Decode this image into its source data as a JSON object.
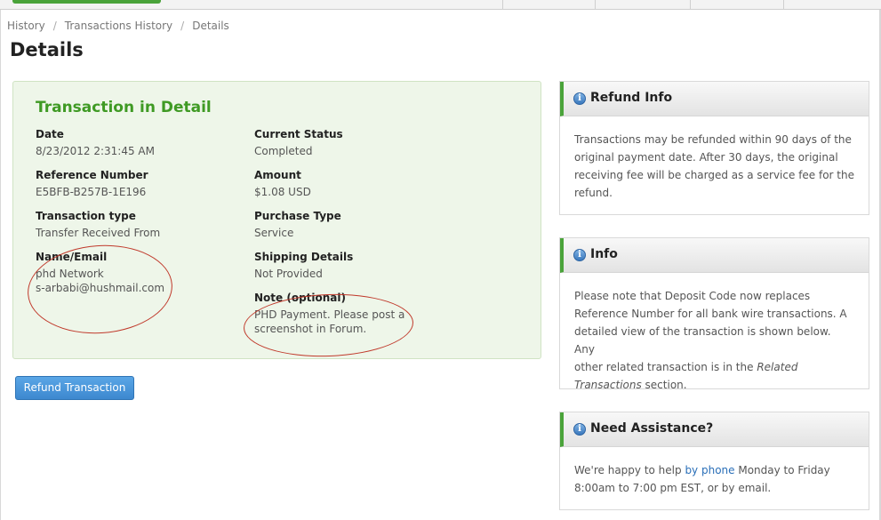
{
  "breadcrumb": {
    "items": [
      "History",
      "Transactions History",
      "Details"
    ],
    "separator": "/"
  },
  "page_title": "Details",
  "transaction": {
    "heading": "Transaction in Detail",
    "date": {
      "label": "Date",
      "value": "8/23/2012 2:31:45 AM"
    },
    "current_status": {
      "label": "Current Status",
      "value": "Completed"
    },
    "reference_number": {
      "label": "Reference Number",
      "value": "E5BFB-B257B-1E196"
    },
    "amount": {
      "label": "Amount",
      "value": "$1.08 USD"
    },
    "transaction_type": {
      "label": "Transaction type",
      "value": "Transfer Received From"
    },
    "purchase_type": {
      "label": "Purchase Type",
      "value": "Service"
    },
    "name_email": {
      "label": "Name/Email",
      "name": "phd Network",
      "email": "s-arbabi@hushmail.com"
    },
    "shipping_details": {
      "label": "Shipping Details",
      "value": "Not Provided"
    },
    "note": {
      "label": "Note (optional)",
      "line1": "PHD Payment. Please post a",
      "line2": "screenshot in Forum."
    }
  },
  "refund_button_label": "Refund Transaction",
  "sidebar": {
    "refund_info": {
      "title": "Refund Info",
      "lines": [
        "Transactions may be refunded within 90 days of the",
        "original payment date. After 30 days, the original",
        "receiving fee will be charged as a service fee for the",
        "refund."
      ]
    },
    "info": {
      "title": "Info",
      "lines": [
        "Please note that Deposit Code now replaces",
        "Reference Number for all bank wire transactions. A",
        "detailed view of the transaction is shown below. Any",
        "other related transaction is in the"
      ],
      "emphasis_line1": "Related",
      "emphasis_line2": "Transactions",
      "tail": " section."
    },
    "assistance": {
      "title": "Need Assistance?",
      "text_before": "We're happy to help ",
      "link": "by phone",
      "text_after": " Monday to Friday",
      "line2": "8:00am to 7:00 pm EST, or by email."
    }
  },
  "colors": {
    "accent_green": "#3f9a24",
    "panel_bg": "#eef6e9",
    "button_blue": "#3d88cf",
    "link_blue": "#2a6fb8",
    "annotation_red": "#c0392b"
  },
  "icons": {
    "sidebar_header_icon": "info-icon"
  }
}
